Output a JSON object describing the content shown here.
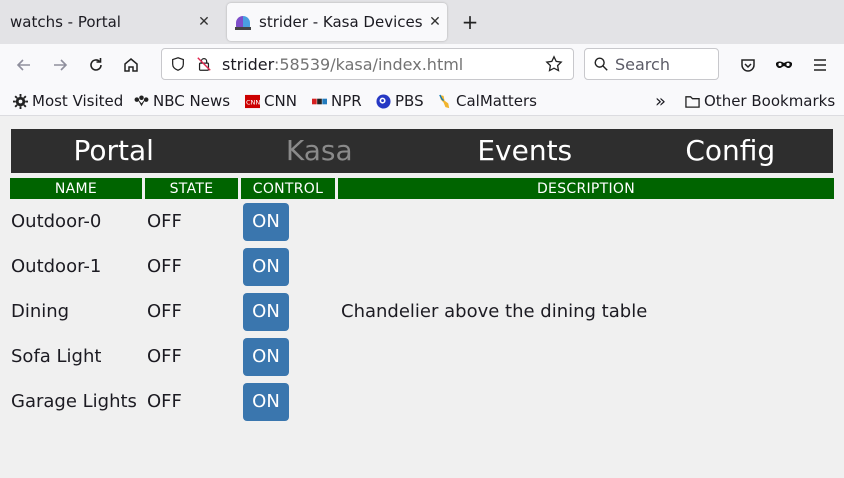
{
  "browser": {
    "tabs": [
      {
        "title": "watchs - Portal",
        "close": "✕"
      },
      {
        "title": "strider - Kasa Devices",
        "close": "✕"
      }
    ],
    "new_tab": "+",
    "url_host": "strider",
    "url_rest": ":58539/kasa/index.html",
    "search_placeholder": "Search",
    "bookmarks": [
      "Most Visited",
      "NBC News",
      "CNN",
      "NPR",
      "PBS",
      "CalMatters"
    ],
    "other_bookmarks": "Other Bookmarks",
    "overflow": "»"
  },
  "site_nav": {
    "items": [
      "Portal",
      "Kasa",
      "Events",
      "Config"
    ]
  },
  "table": {
    "headers": {
      "name": "NAME",
      "state": "STATE",
      "control": "CONTROL",
      "description": "DESCRIPTION"
    },
    "rows": [
      {
        "name": "Outdoor-0",
        "state": "OFF",
        "control": "ON",
        "description": ""
      },
      {
        "name": "Outdoor-1",
        "state": "OFF",
        "control": "ON",
        "description": ""
      },
      {
        "name": "Dining",
        "state": "OFF",
        "control": "ON",
        "description": "Chandelier above the dining table"
      },
      {
        "name": "Sofa Light",
        "state": "OFF",
        "control": "ON",
        "description": ""
      },
      {
        "name": "Garage Lights",
        "state": "OFF",
        "control": "ON",
        "description": ""
      }
    ]
  },
  "colors": {
    "header_green": "#006400",
    "nav_dark": "#2e2e2e",
    "button_blue": "#3a76ae"
  }
}
